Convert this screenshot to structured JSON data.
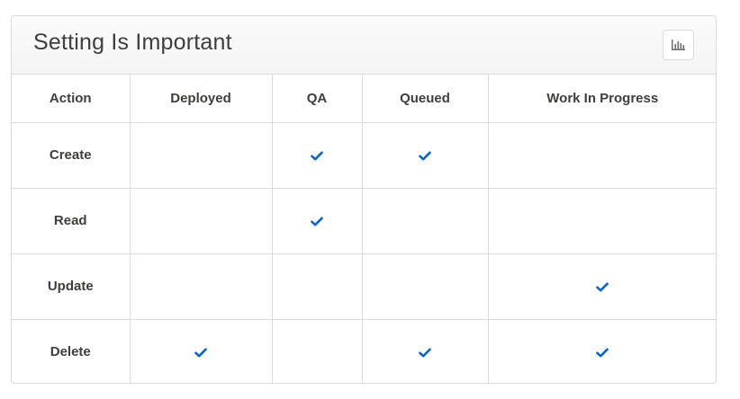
{
  "card": {
    "title": "Setting Is Important",
    "chart_button_icon": "bar-chart-icon"
  },
  "table": {
    "columns": [
      "Action",
      "Deployed",
      "QA",
      "Queued",
      "Work In Progress"
    ],
    "rows": [
      {
        "action": "Create",
        "checks": [
          false,
          true,
          true,
          false
        ]
      },
      {
        "action": "Read",
        "checks": [
          false,
          true,
          false,
          false
        ]
      },
      {
        "action": "Update",
        "checks": [
          false,
          false,
          false,
          true
        ]
      },
      {
        "action": "Delete",
        "checks": [
          true,
          false,
          true,
          true
        ]
      }
    ],
    "check_icon": "checkmark-icon",
    "check_color": "#0b66c3"
  }
}
